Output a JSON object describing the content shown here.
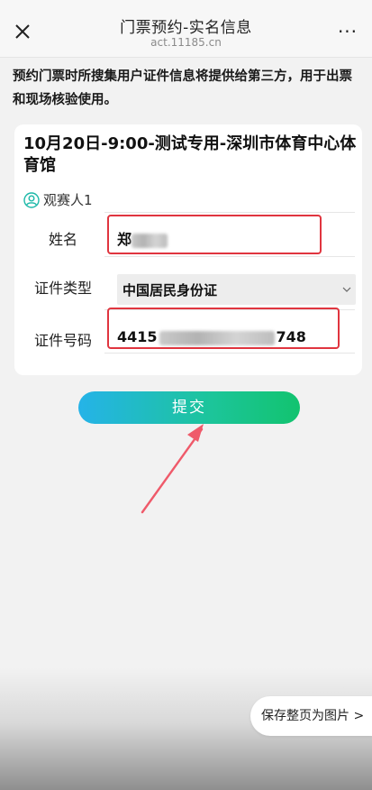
{
  "header": {
    "title": "门票预约-实名信息",
    "subtitle": "act.11185.cn",
    "more_label": "···"
  },
  "notice": "预约门票时所搜集用户证件信息将提供给第三方，用于出票和现场核验使用。",
  "event": {
    "title": "10月20日-9:00-测试专用-深圳市体育中心体育馆",
    "spectator_label": "观赛人1"
  },
  "form": {
    "name_label": "姓名",
    "name_value_visible": "郑",
    "id_type_label": "证件类型",
    "id_type_value": "中国居民身份证",
    "id_number_label": "证件号码",
    "id_number_prefix": "4415",
    "id_number_suffix": "748"
  },
  "submit_label": "提交",
  "save_page_label": "保存整页为图片 >",
  "colors": {
    "highlight_border": "#e0353f",
    "submit_gradient_start": "#25b3e8",
    "submit_gradient_end": "#12c36f",
    "accent_teal": "#1cb8a8"
  }
}
